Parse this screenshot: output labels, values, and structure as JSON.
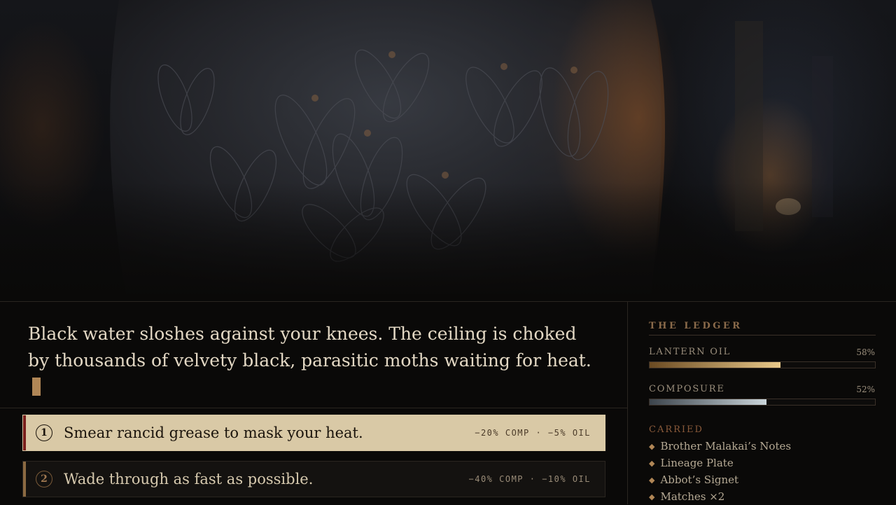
{
  "narrative": {
    "text": "Black water sloshes against your knees. The ceiling is choked by thousands of velvety black, parasitic moths waiting for heat."
  },
  "choices": [
    {
      "number": "1",
      "text": "Smear rancid grease to mask your heat.",
      "cost": "−20% COMP · −5% OIL",
      "selected": true
    },
    {
      "number": "2",
      "text": "Wade through as fast as possible.",
      "cost": "−40% COMP · −10% OIL",
      "selected": false
    }
  ],
  "ledger": {
    "title": "THE LEDGER",
    "stats": [
      {
        "label": "LANTERN OIL",
        "value_text": "58%",
        "value": 0.58,
        "colors": [
          "#6a4a22",
          "#e9c98a"
        ]
      },
      {
        "label": "COMPOSURE",
        "value_text": "52%",
        "value": 0.52,
        "colors": [
          "#3c444c",
          "#cad5da"
        ]
      }
    ],
    "carried_label": "CARRIED",
    "carried": [
      "Brother Malakai’s Notes",
      "Lineage Plate",
      "Abbot’s Signet",
      "Matches ×2"
    ]
  },
  "colors": {
    "background": "#0a0908",
    "accent_gold": "#b08656",
    "selected_choice": "#d9c9a6",
    "selected_edge": "#7a1f1c"
  },
  "icons": {
    "item_bullet": "diamond-icon",
    "text_cursor": "cursor-block-icon"
  }
}
